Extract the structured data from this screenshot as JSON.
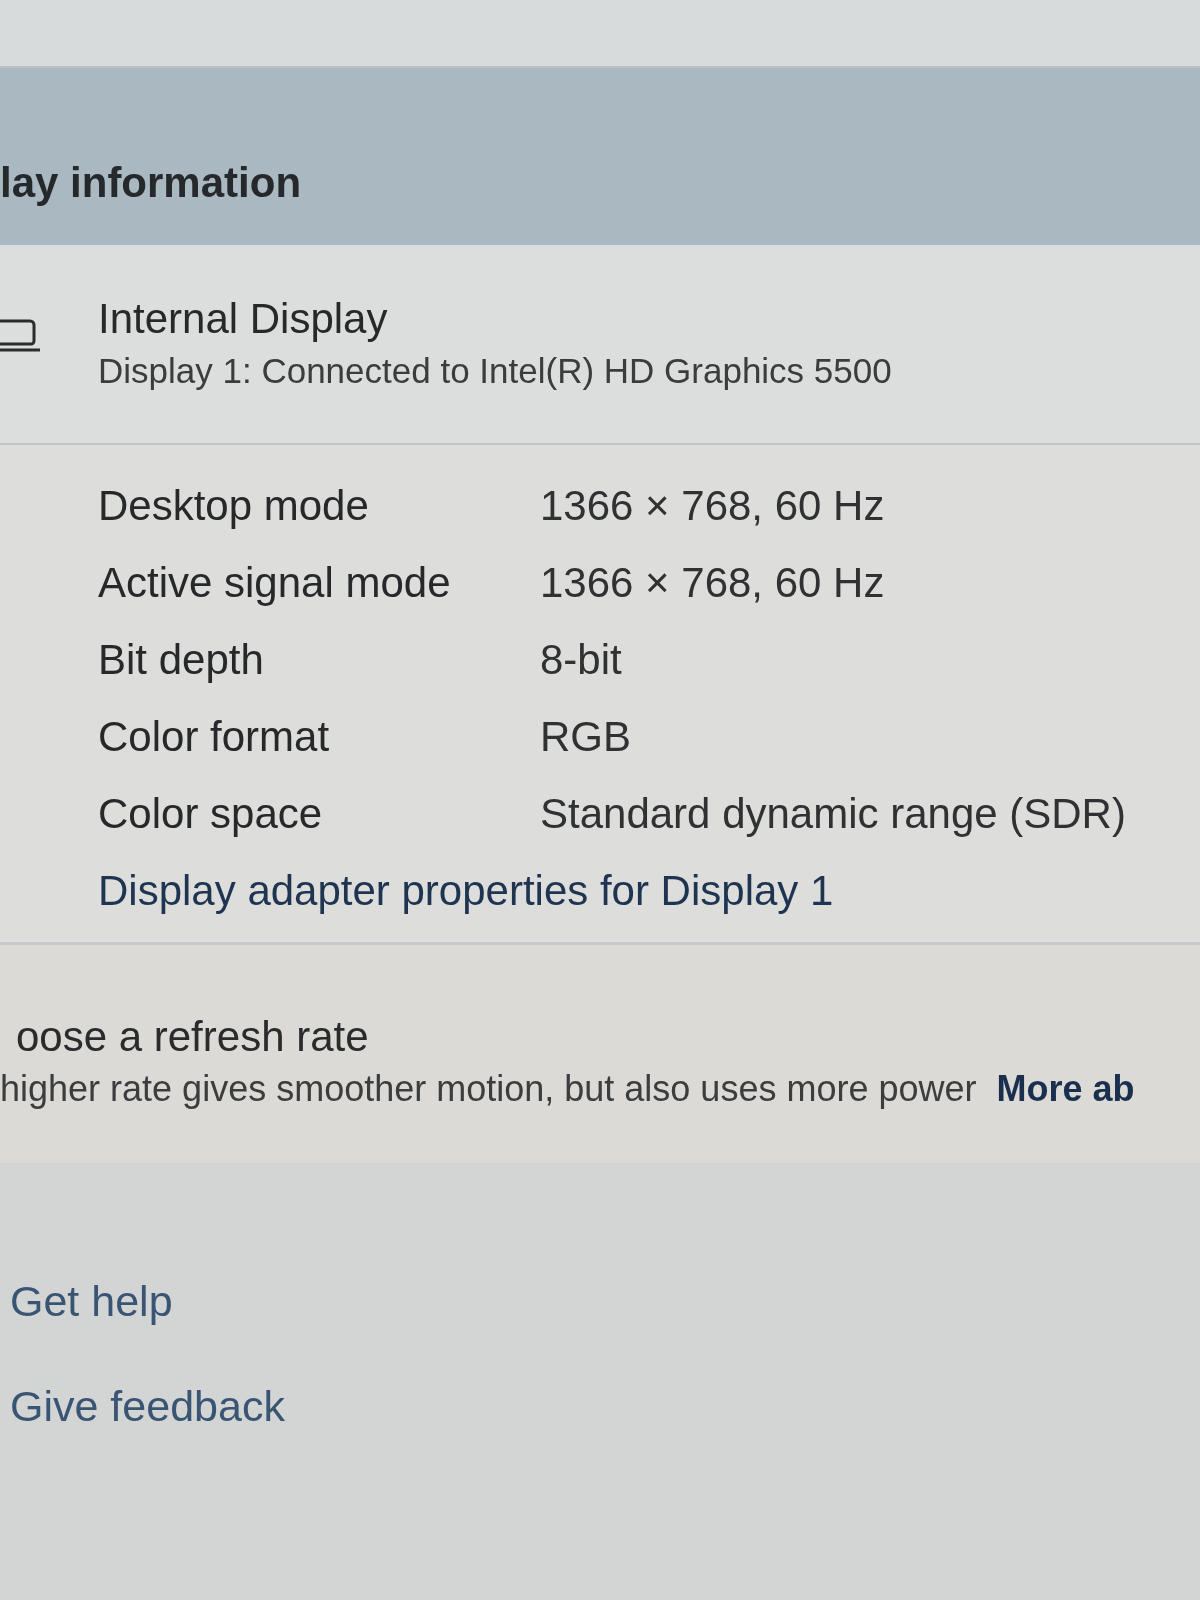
{
  "section": {
    "title": "lay information"
  },
  "display": {
    "name": "Internal Display",
    "description": "Display 1: Connected to Intel(R) HD Graphics 5500"
  },
  "properties": [
    {
      "label": "Desktop mode",
      "value": "1366 × 768, 60 Hz"
    },
    {
      "label": "Active signal mode",
      "value": "1366 × 768, 60 Hz"
    },
    {
      "label": "Bit depth",
      "value": "8-bit"
    },
    {
      "label": "Color format",
      "value": "RGB"
    },
    {
      "label": "Color space",
      "value": "Standard dynamic range (SDR)"
    }
  ],
  "adapter_link": "Display adapter properties for Display 1",
  "refresh_rate": {
    "title": "oose a refresh rate",
    "description": "higher rate gives smoother motion, but also uses more power",
    "link": "More ab"
  },
  "help_links": [
    "Get help",
    "Give feedback"
  ]
}
